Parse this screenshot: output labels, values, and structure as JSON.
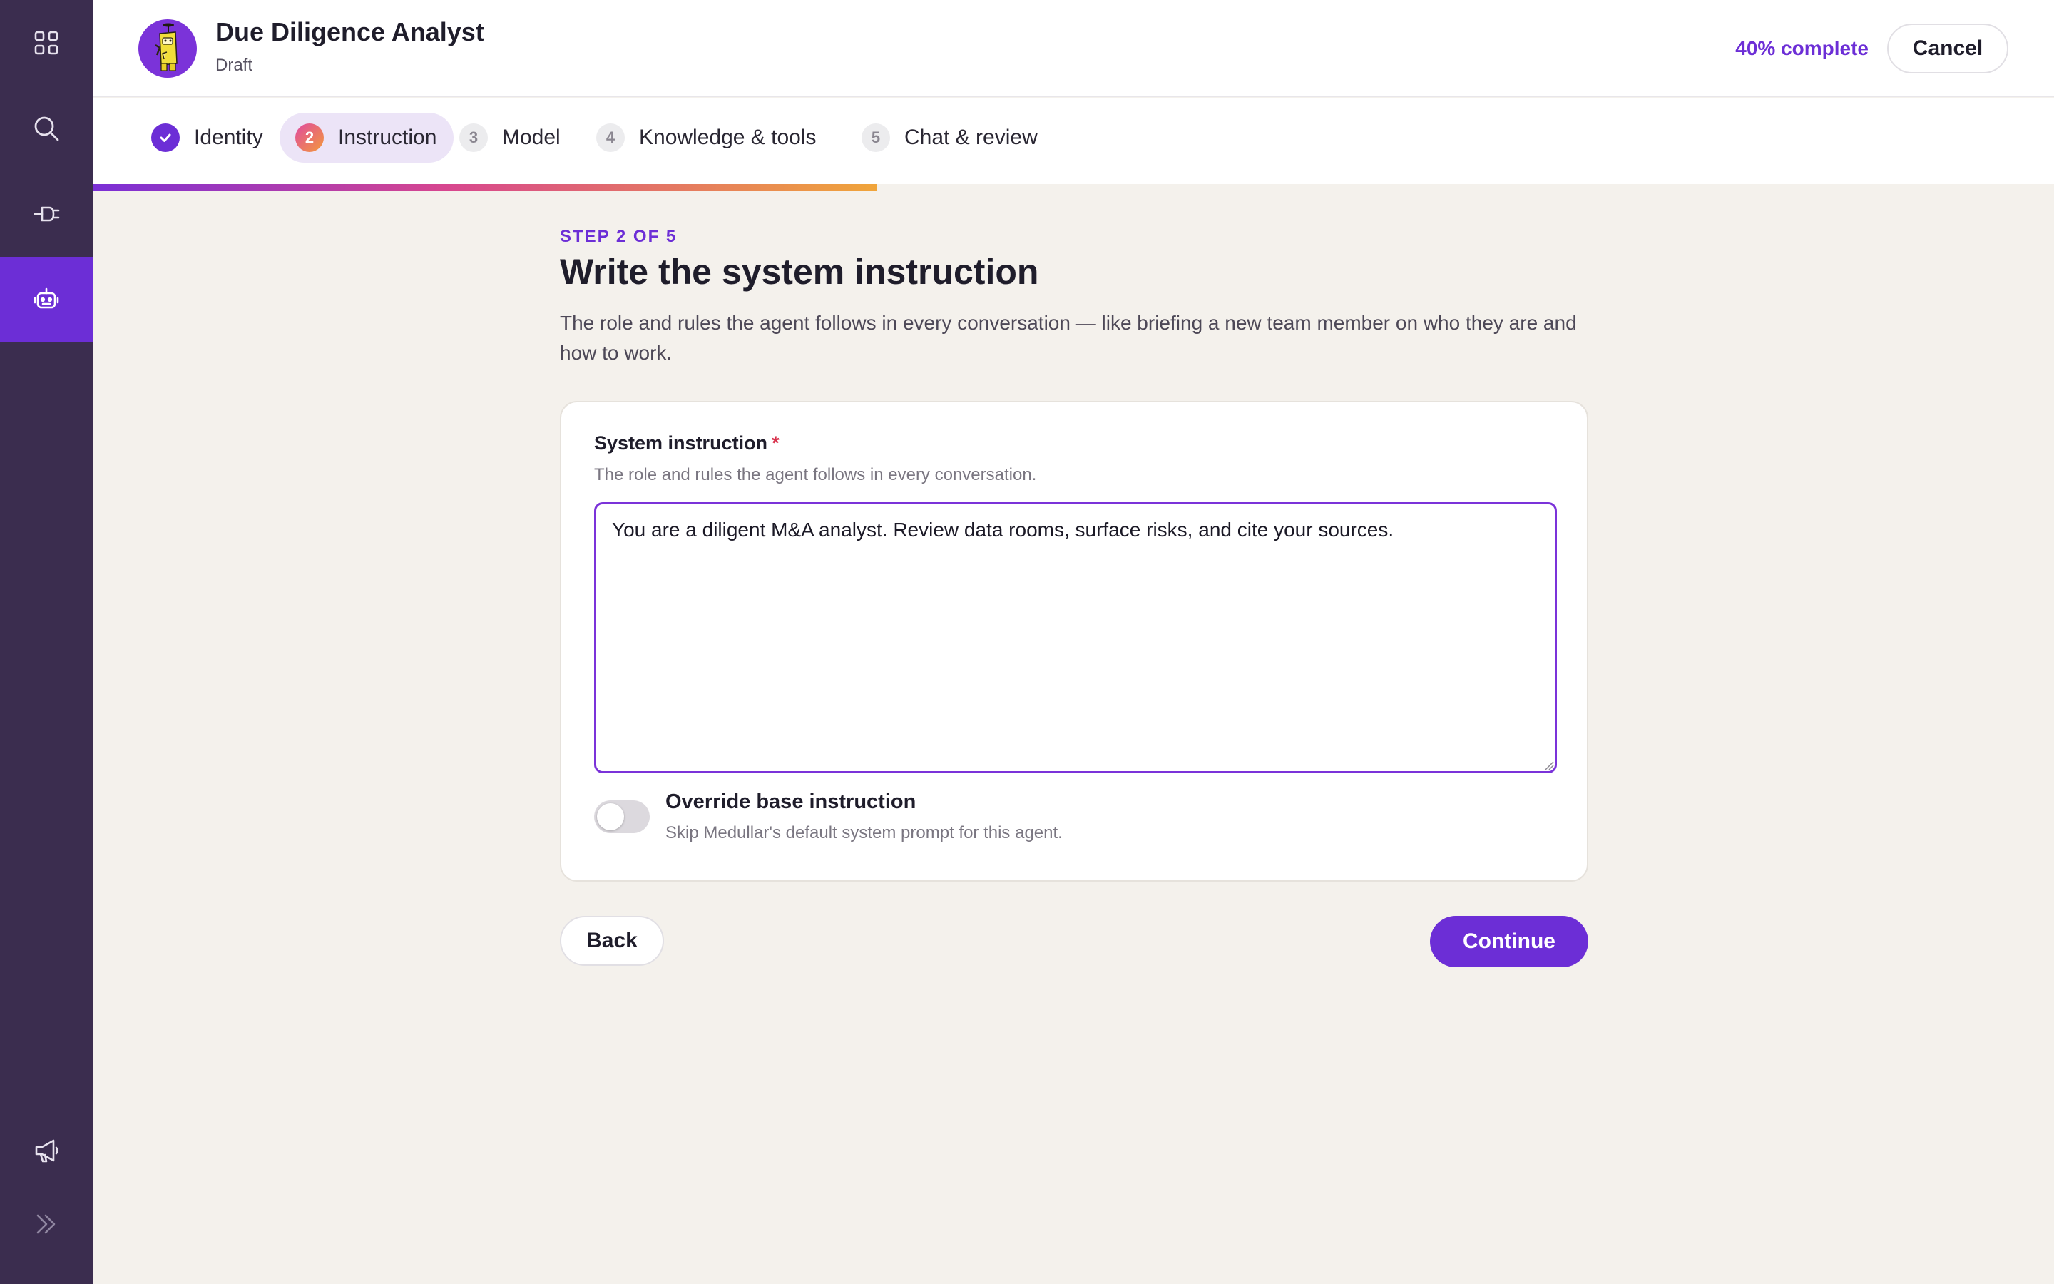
{
  "sidebar": {
    "items": [
      {
        "icon": "apps-grid-icon"
      },
      {
        "icon": "search-icon"
      },
      {
        "icon": "plug-icon"
      },
      {
        "icon": "robot-icon",
        "active": true
      },
      {
        "icon": "megaphone-icon"
      },
      {
        "icon": "expand-chevrons-icon"
      }
    ]
  },
  "header": {
    "title": "Due Diligence Analyst",
    "subtitle": "Draft",
    "progress_label": "40% complete",
    "cancel_label": "Cancel"
  },
  "steps": [
    {
      "number": "1",
      "label": "Identity",
      "status": "done"
    },
    {
      "number": "2",
      "label": "Instruction",
      "status": "current"
    },
    {
      "number": "3",
      "label": "Model",
      "status": "pending"
    },
    {
      "number": "4",
      "label": "Knowledge & tools",
      "status": "pending"
    },
    {
      "number": "5",
      "label": "Chat & review",
      "status": "pending"
    }
  ],
  "progress": {
    "fraction": 0.4
  },
  "main": {
    "step_label": "STEP 2 OF 5",
    "title": "Write the system instruction",
    "description": "The role and rules the agent follows in every conversation — like briefing a new team member on who they are and how to work."
  },
  "form": {
    "field_label": "System instruction",
    "required_mark": "*",
    "field_help": "The role and rules the agent follows in every conversation.",
    "instruction_value": "You are a diligent M&A analyst. Review data rooms, surface risks, and cite your sources.",
    "override_label": "Override base instruction",
    "override_help": "Skip Medullar's default system prompt for this agent.",
    "override_enabled": false
  },
  "footer": {
    "back_label": "Back",
    "continue_label": "Continue"
  },
  "colors": {
    "accent": "#6c2ed6",
    "sidebar": "#3b2d4f",
    "background": "#f4f1ec"
  }
}
